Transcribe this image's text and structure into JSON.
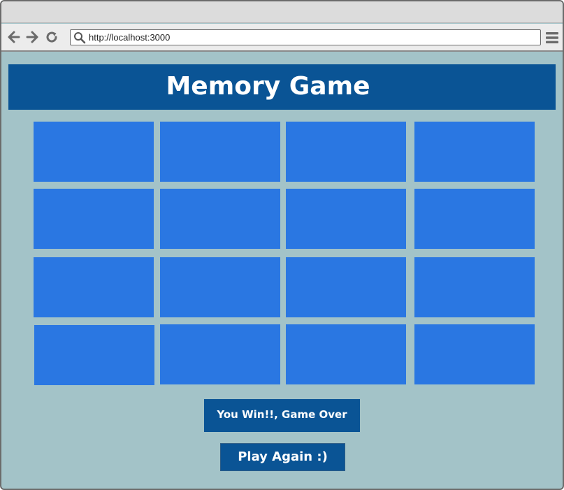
{
  "browser": {
    "url": "http://localhost:3000"
  },
  "game": {
    "title": "Memory Game",
    "status": "You Win!!, Game Over",
    "play_again_label": "Play Again :)",
    "cards_face_down": 16
  },
  "colors": {
    "page_background": "#a3c3c8",
    "header_background": "#0a5495",
    "card_back": "#2a77e2",
    "button_background": "#0a5495",
    "text_light": "#ffffff"
  }
}
